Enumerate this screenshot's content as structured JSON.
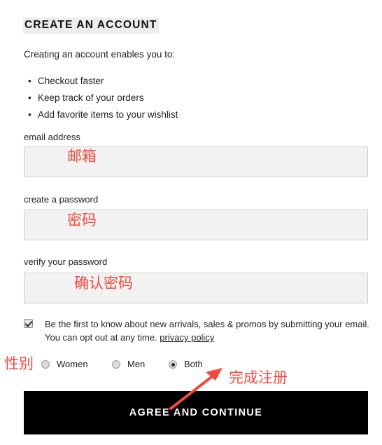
{
  "heading": "CREATE AN ACCOUNT",
  "intro": "Creating an account enables you to:",
  "benefits": [
    {
      "bullet": "•",
      "text": "Checkout faster"
    },
    {
      "bullet": "•",
      "text": "Keep track of your orders"
    },
    {
      "bullet": "•",
      "text": "Add favorite items to your wishlist"
    }
  ],
  "fields": {
    "email": {
      "label": "email address",
      "value": "",
      "placeholder": ""
    },
    "password": {
      "label": "create a password",
      "value": "",
      "placeholder": ""
    },
    "verify": {
      "label": "verify your password",
      "value": "",
      "placeholder": ""
    }
  },
  "optin": {
    "checked": true,
    "text_before": "Be the first to know about new arrivals, sales & promos by submitting your email. You can opt out at any time. ",
    "link_label": "privacy policy"
  },
  "gender": {
    "options": [
      {
        "label": "Women",
        "selected": false
      },
      {
        "label": "Men",
        "selected": false
      },
      {
        "label": "Both",
        "selected": true
      }
    ]
  },
  "submit": {
    "label": "AGREE AND CONTINUE"
  },
  "annotations": {
    "email": "邮箱",
    "password": "密码",
    "verify": "确认密码",
    "gender": "性别",
    "submit": "完成注册",
    "color": "#f4493f"
  },
  "colors": {
    "button_bg": "#000000",
    "button_text": "#ffffff",
    "field_bg": "#f2f2f2",
    "field_border": "#cfcfcf",
    "heading_highlight": "#ededed",
    "text": "#222222"
  }
}
